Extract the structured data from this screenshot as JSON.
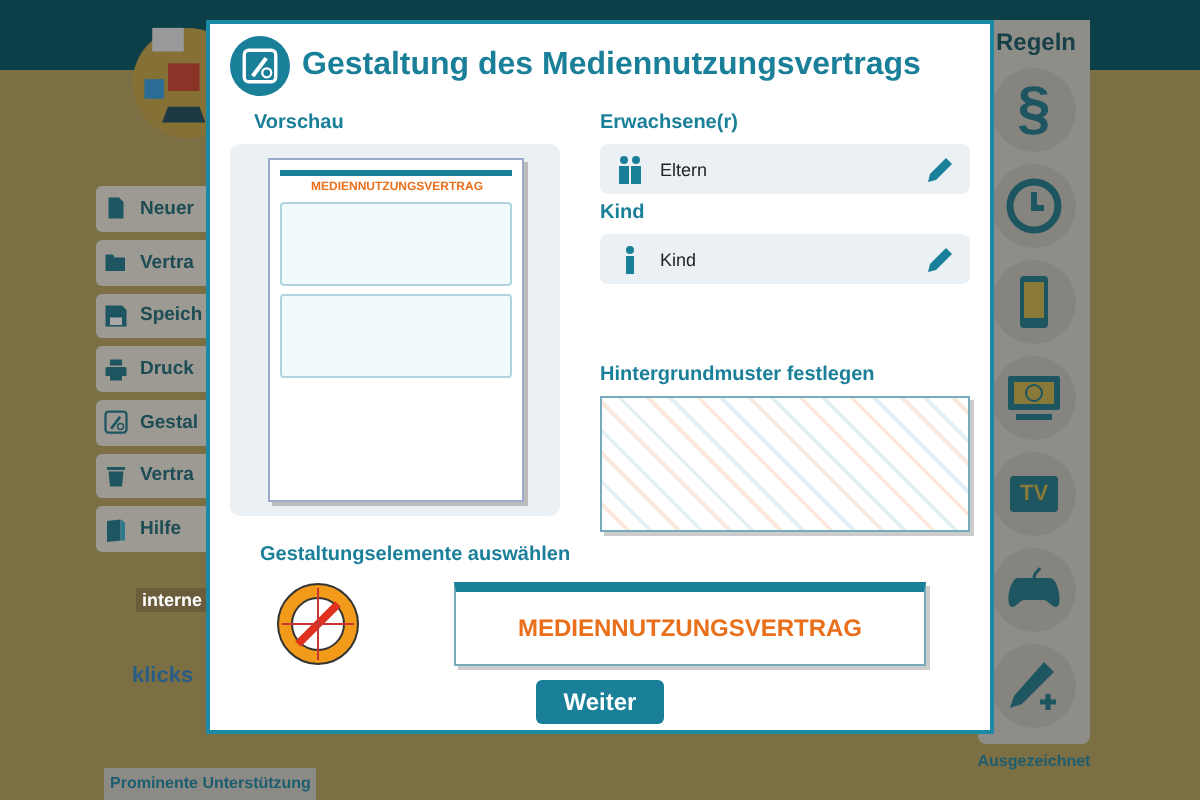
{
  "left_menu": [
    {
      "kind": "new",
      "label": "Neuer"
    },
    {
      "kind": "open",
      "label": "Vertra"
    },
    {
      "kind": "save",
      "label": "Speich"
    },
    {
      "kind": "print",
      "label": "Druck"
    },
    {
      "kind": "design",
      "label": "Gestal"
    },
    {
      "kind": "delete",
      "label": "Vertra"
    },
    {
      "kind": "help",
      "label": "Hilfe"
    }
  ],
  "logos": {
    "badge": "interne",
    "brand": "klicks"
  },
  "support_note": "Prominente Unterstützung",
  "rules_panel": {
    "title": "Regeln",
    "items": [
      {
        "kind": "paragraph",
        "text": "§"
      },
      {
        "kind": "clock"
      },
      {
        "kind": "phone"
      },
      {
        "kind": "computer"
      },
      {
        "kind": "tv",
        "text": "TV"
      },
      {
        "kind": "gamepad"
      },
      {
        "kind": "add"
      }
    ]
  },
  "award": "Ausgezeichnet",
  "dialog": {
    "title": "Gestaltung des Mediennutzungsvertrags",
    "preview_label": "Vorschau",
    "preview_document": {
      "title": "MEDIENNUTZUNGSVERTRAG"
    },
    "adult": {
      "label": "Erwachsene(r)",
      "value": "Eltern"
    },
    "child": {
      "label": "Kind",
      "value": "Kind"
    },
    "pattern_label": "Hintergrundmuster festlegen",
    "elements_label": "Gestaltungselemente auswählen",
    "banner_text": "MEDIENNUTZUNGSVERTRAG",
    "button": "Weiter"
  }
}
